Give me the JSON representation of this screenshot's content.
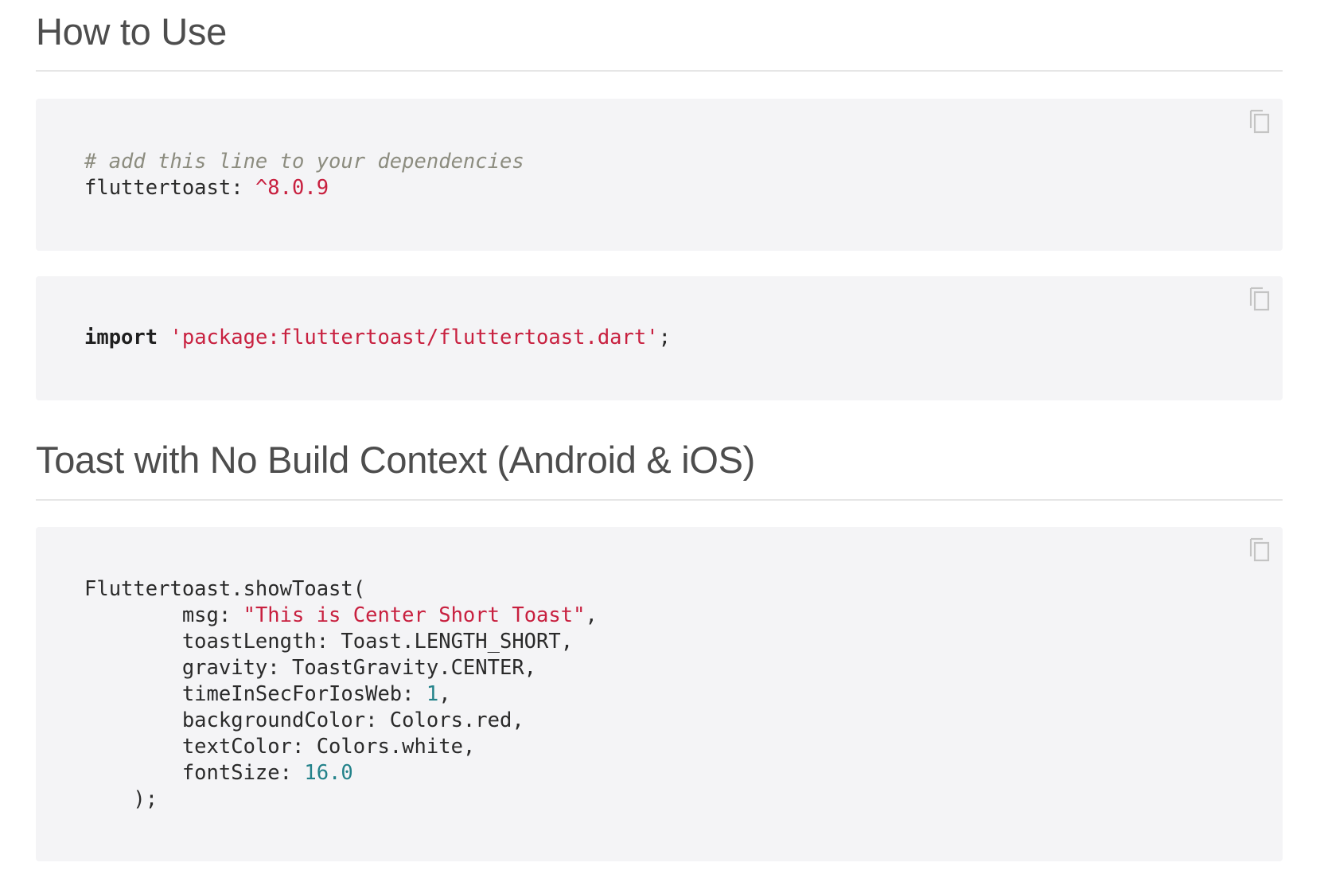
{
  "sections": [
    {
      "heading": "How to Use",
      "code_blocks": [
        {
          "copy_icon": "copy-icon",
          "lines": [
            [
              {
                "text": "# add this line to your dependencies",
                "kind": "comment"
              }
            ],
            [
              {
                "text": "fluttertoast: ",
                "kind": "plain"
              },
              {
                "text": "^8.0.9",
                "kind": "string"
              }
            ]
          ]
        },
        {
          "copy_icon": "copy-icon",
          "lines": [
            [
              {
                "text": "import",
                "kind": "keyword"
              },
              {
                "text": " ",
                "kind": "plain"
              },
              {
                "text": "'package:fluttertoast/fluttertoast.dart'",
                "kind": "string"
              },
              {
                "text": ";",
                "kind": "plain"
              }
            ]
          ]
        }
      ]
    },
    {
      "heading": "Toast with No Build Context (Android & iOS)",
      "code_blocks": [
        {
          "copy_icon": "copy-icon",
          "lines": [
            [
              {
                "text": "Fluttertoast.showToast(",
                "kind": "plain"
              }
            ],
            [
              {
                "text": "        msg: ",
                "kind": "plain"
              },
              {
                "text": "\"This is Center Short Toast\"",
                "kind": "string"
              },
              {
                "text": ",",
                "kind": "plain"
              }
            ],
            [
              {
                "text": "        toastLength: Toast.LENGTH_SHORT,",
                "kind": "plain"
              }
            ],
            [
              {
                "text": "        gravity: ToastGravity.CENTER,",
                "kind": "plain"
              }
            ],
            [
              {
                "text": "        timeInSecForIosWeb: ",
                "kind": "plain"
              },
              {
                "text": "1",
                "kind": "number"
              },
              {
                "text": ",",
                "kind": "plain"
              }
            ],
            [
              {
                "text": "        backgroundColor: Colors.red,",
                "kind": "plain"
              }
            ],
            [
              {
                "text": "        textColor: Colors.white,",
                "kind": "plain"
              }
            ],
            [
              {
                "text": "        fontSize: ",
                "kind": "plain"
              },
              {
                "text": "16.0",
                "kind": "number"
              }
            ],
            [
              {
                "text": "    );",
                "kind": "plain"
              }
            ]
          ]
        }
      ]
    }
  ],
  "colors": {
    "code_background": "#f4f4f6",
    "string": "#c8203f",
    "number": "#23828a",
    "comment": "#8c8c7f",
    "heading": "#4d4d4d",
    "rule": "#e6e6e6",
    "icon": "#c4c4c4"
  }
}
